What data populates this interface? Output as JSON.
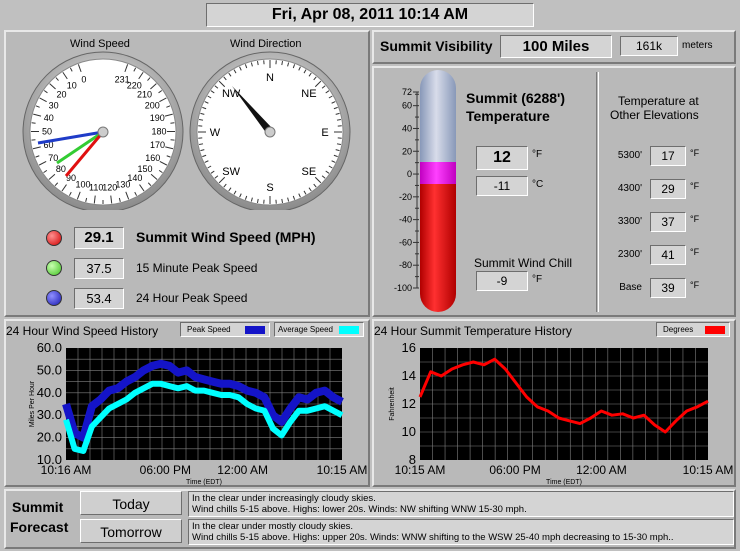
{
  "datetime": "Fri, Apr 08, 2011  10:14 AM",
  "wind": {
    "speed_title": "Wind Speed",
    "direction_title": "Wind Direction",
    "speed_ticks": [
      "0",
      "10",
      "20",
      "30",
      "40",
      "50",
      "60",
      "70",
      "80",
      "90",
      "100",
      "110",
      "120",
      "130",
      "140",
      "150",
      "160",
      "170",
      "180",
      "190",
      "200",
      "210",
      "220",
      "231"
    ],
    "compass": [
      "N",
      "NE",
      "E",
      "SE",
      "S",
      "SW",
      "W",
      "NW"
    ],
    "summit_speed": "29.1",
    "summit_speed_label": "Summit Wind Speed (MPH)",
    "peak15": "37.5",
    "peak15_label": "15 Minute Peak Speed",
    "peak24": "53.4",
    "peak24_label": "24 Hour Peak Speed"
  },
  "visibility": {
    "label": "Summit Visibility",
    "value": "100 Miles",
    "meters": "161k",
    "meters_unit": "meters"
  },
  "temperature": {
    "title_line1": "Summit (6288')",
    "title_line2": "Temperature",
    "scale": [
      "72",
      "60",
      "40",
      "20",
      "0",
      "-20",
      "-40",
      "-60",
      "-80",
      "-100"
    ],
    "f_value": "12",
    "f_unit": "°F",
    "c_value": "-11",
    "c_unit": "°C",
    "windchill_label": "Summit Wind Chill",
    "windchill_value": "-9",
    "windchill_unit": "°F",
    "other_title_1": "Temperature at",
    "other_title_2": "Other Elevations",
    "elevations": [
      {
        "label": "5300'",
        "value": "17",
        "unit": "°F"
      },
      {
        "label": "4300'",
        "value": "29",
        "unit": "°F"
      },
      {
        "label": "3300'",
        "value": "37",
        "unit": "°F"
      },
      {
        "label": "2300'",
        "value": "41",
        "unit": "°F"
      },
      {
        "label": "Base",
        "value": "39",
        "unit": "°F"
      }
    ]
  },
  "wind_history": {
    "title": "24 Hour Wind Speed History",
    "legend_peak": "Peak Speed",
    "legend_avg": "Average Speed",
    "ylabel": "Miles Per Hour",
    "xlabel": "Time (EDT)",
    "yticks": [
      "60.0",
      "50.0",
      "40.0",
      "30.0",
      "20.0",
      "10.0"
    ],
    "xticks": [
      "10:16 AM",
      "06:00 PM",
      "12:00 AM",
      "10:15 AM"
    ]
  },
  "temp_history": {
    "title": "24 Hour Summit Temperature History",
    "legend": "Degrees",
    "ylabel": "Fahrenheit",
    "xlabel": "Time (EDT)",
    "yticks": [
      "16",
      "14",
      "12",
      "10",
      "8"
    ],
    "xticks": [
      "10:15 AM",
      "06:00 PM",
      "12:00 AM",
      "10:15 AM"
    ]
  },
  "forecast": {
    "title_1": "Summit",
    "title_2": "Forecast",
    "today_label": "Today",
    "today_text_1": "In the clear under increasingly cloudy skies.",
    "today_text_2": "Wind chills  5-15 above.  Highs: lower 20s.  Winds: NW shifting WNW 15-30 mph.",
    "tomorrow_label": "Tomorrow",
    "tomorrow_text_1": "In the clear under mostly cloudy skies.",
    "tomorrow_text_2": "Wind chills  5-15 above.  Highs: upper 20s.  Winds: WNW shifting to the WSW 25-40 mph decreasing to 15-30 mph.."
  },
  "chart_data": [
    {
      "type": "line",
      "title": "24 Hour Wind Speed History",
      "xlabel": "Time (EDT)",
      "ylabel": "Miles Per Hour",
      "ylim": [
        10,
        60
      ],
      "xticks": [
        "10:16 AM",
        "06:00 PM",
        "12:00 AM",
        "10:15 AM"
      ],
      "colors": {
        "peak": "#1414c8",
        "avg": "#00ffff"
      },
      "series": [
        {
          "name": "Peak Speed",
          "values": [
            35,
            22,
            20,
            34,
            37,
            41,
            42,
            45,
            47,
            50,
            52,
            53,
            52,
            49,
            50,
            47,
            46,
            45,
            44,
            44,
            43,
            41,
            40,
            38,
            30,
            27,
            33,
            38,
            37,
            40,
            41,
            38,
            36
          ]
        },
        {
          "name": "Average Speed",
          "values": [
            28,
            15,
            14,
            25,
            29,
            33,
            35,
            37,
            40,
            42,
            44,
            44,
            43,
            42,
            43,
            41,
            41,
            40,
            39,
            39,
            38,
            35,
            33,
            32,
            24,
            21,
            27,
            32,
            32,
            33,
            34,
            32,
            30
          ]
        }
      ]
    },
    {
      "type": "line",
      "title": "24 Hour Summit Temperature History",
      "xlabel": "Time (EDT)",
      "ylabel": "Fahrenheit",
      "ylim": [
        8,
        16
      ],
      "xticks": [
        "10:15 AM",
        "06:00 PM",
        "12:00 AM",
        "10:15 AM"
      ],
      "colors": {
        "temp": "#ff0000"
      },
      "series": [
        {
          "name": "Degrees",
          "values": [
            12.5,
            14.3,
            14.0,
            14.5,
            14.8,
            15.0,
            14.8,
            15.2,
            14.5,
            13.5,
            12.5,
            11.8,
            11.5,
            11.0,
            10.8,
            10.6,
            11.0,
            11.5,
            11.2,
            11.3,
            11.0,
            11.2,
            10.5,
            10.0,
            10.8,
            11.5,
            11.8,
            12.2
          ]
        }
      ]
    }
  ]
}
